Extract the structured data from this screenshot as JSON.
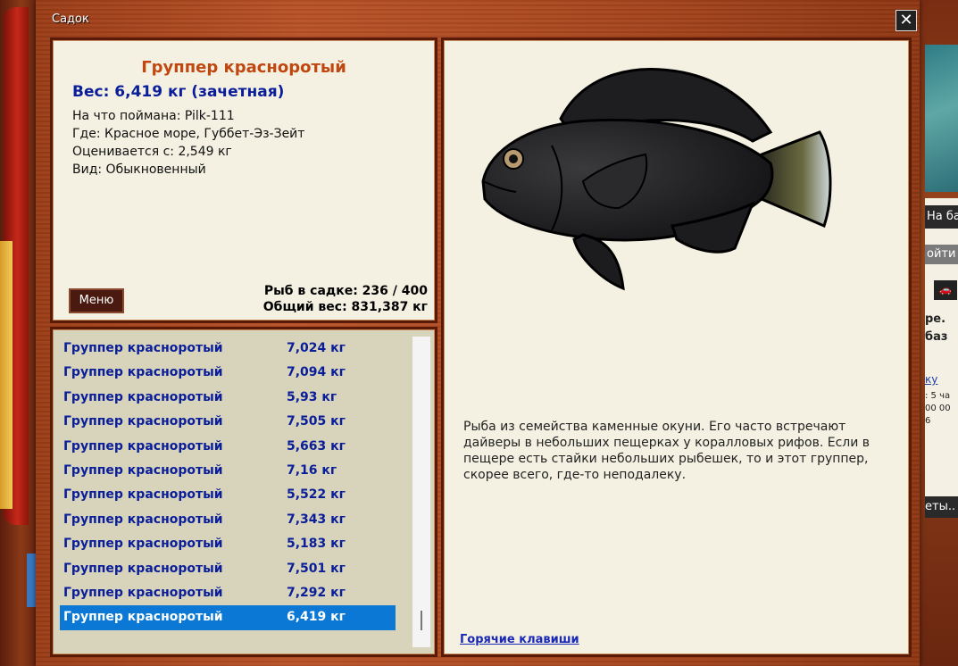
{
  "window": {
    "title": "Садок",
    "close_glyph": "✕"
  },
  "fish": {
    "name": "Группер красноротый",
    "weight": "Вес: 6,419 кг (зачетная)",
    "caught_with": "На что поймана: Pilk-111",
    "location": "Где: Красное море, Губбет-Эз-Зейт",
    "valued_from": "Оценивается с: 2,549 кг",
    "kind": "Вид: Обыкновенный",
    "description": "Рыба из семейства каменные окуни. Его часто встречают дайверы в небольших пещерках у коралловых рифов. Если в пещере есть стайки небольших рыбешек, то и этот группер, скорее всего, где-то неподалеку."
  },
  "buttons": {
    "menu": "Меню",
    "hotkeys": "Горячие клавиши"
  },
  "stats": {
    "count": "Рыб в садке: 236 / 400",
    "total_weight": "Общий вес: 831,387 кг"
  },
  "catch_list": [
    {
      "name": "Группер красноротый",
      "weight": "7,024 кг"
    },
    {
      "name": "Группер красноротый",
      "weight": "7,094 кг"
    },
    {
      "name": "Группер красноротый",
      "weight": "5,93 кг"
    },
    {
      "name": "Группер красноротый",
      "weight": "7,505 кг"
    },
    {
      "name": "Группер красноротый",
      "weight": "5,663 кг"
    },
    {
      "name": "Группер красноротый",
      "weight": "7,16 кг"
    },
    {
      "name": "Группер красноротый",
      "weight": "5,522 кг"
    },
    {
      "name": "Группер красноротый",
      "weight": "7,343 кг"
    },
    {
      "name": "Группер красноротый",
      "weight": "5,183 кг"
    },
    {
      "name": "Группер красноротый",
      "weight": "7,501 кг"
    },
    {
      "name": "Группер красноротый",
      "weight": "7,292 кг"
    },
    {
      "name": "Группер красноротый",
      "weight": "6,419 кг",
      "selected": true
    }
  ],
  "background_app": {
    "na_base": "На ба",
    "go": "ойти",
    "car_icon": "car-icon",
    "text1": "ре.",
    "text2": "баз",
    "link": "ку",
    "line1": ": 5 ча",
    "line2": "00 00",
    "line3": "6",
    "bets": "еты.."
  },
  "colors": {
    "accent_title": "#c04810",
    "weight_blue": "#0a1e9a",
    "selection": "#0a78d4",
    "panel_bg": "#f4f1e2"
  }
}
